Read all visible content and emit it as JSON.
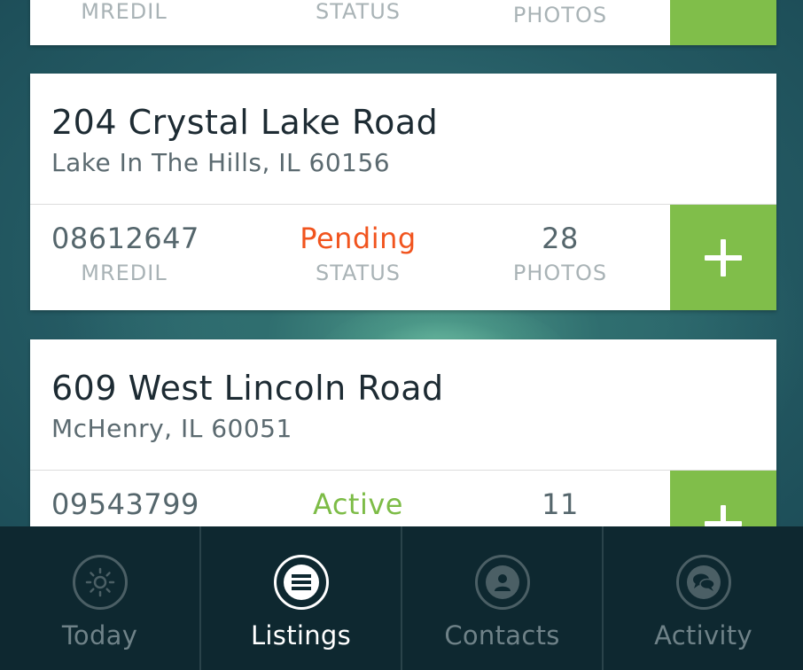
{
  "partial_top_card": {
    "labels": [
      "MREDIL",
      "STATUS",
      "PHOTOS"
    ]
  },
  "listings": [
    {
      "street": "204 Crystal Lake Road",
      "city": "Lake In The Hills, IL 60156",
      "mls": "08612647",
      "mls_label": "MREDIL",
      "status": "Pending",
      "status_label": "STATUS",
      "photos": "28",
      "photos_label": "PHOTOS",
      "status_color": "#f1541e"
    },
    {
      "street": "609 West Lincoln Road",
      "city": "McHenry, IL 60051",
      "mls": "09543799",
      "status": "Active",
      "photos": "11",
      "status_color": "#7dbc47"
    }
  ],
  "tabs": [
    {
      "label": "Today",
      "icon": "sun-icon",
      "active": false
    },
    {
      "label": "Listings",
      "icon": "list-icon",
      "active": true
    },
    {
      "label": "Contacts",
      "icon": "person-icon",
      "active": false
    },
    {
      "label": "Activity",
      "icon": "chat-bubbles-icon",
      "active": false
    }
  ],
  "colors": {
    "accent_green": "#80be4a",
    "tab_bar": "#0e2830"
  }
}
